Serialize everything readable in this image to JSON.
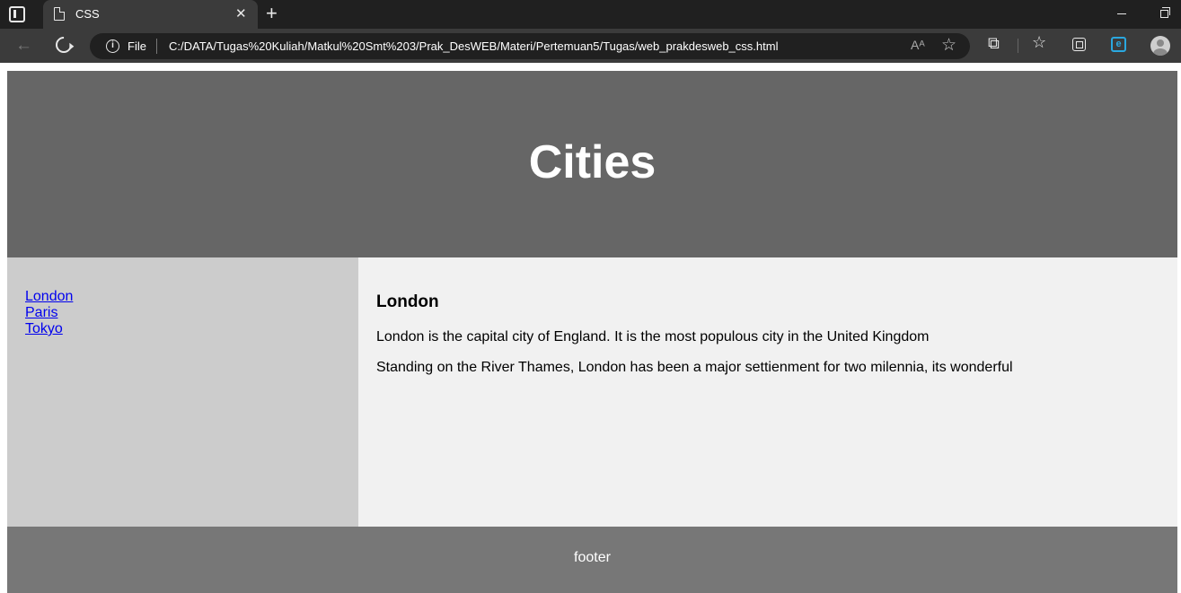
{
  "browser": {
    "tab_title": "CSS",
    "tab_close": "✕",
    "new_tab": "+",
    "back_glyph": "←",
    "file_label": "File",
    "info_glyph": "i",
    "url": "C:/DATA/Tugas%20Kuliah/Matkul%20Smt%203/Prak_DesWEB/Materi/Pertemuan5/Tugas/web_prakdesweb_css.html",
    "read_aloud_glyph": "Aᴬ",
    "add_favorite_glyph": "☆",
    "extensions_glyph": "⧉",
    "favorites_glyph": "☆",
    "edge_glyph": "e"
  },
  "page": {
    "header_title": "Cities",
    "nav_links": [
      "London",
      "Paris",
      "Tokyo"
    ],
    "article_title": "London",
    "paragraphs": [
      "London is the capital city of England. It is the most populous city in the United Kingdom",
      "Standing on the River Thames, London has been a major settienment for two milennia, its wonderful"
    ],
    "footer_text": "footer"
  },
  "colors": {
    "header_bg": "#666666",
    "nav_bg": "#cccccc",
    "article_bg": "#f1f1f1",
    "footer_bg": "#777777",
    "link": "#0000ee"
  }
}
